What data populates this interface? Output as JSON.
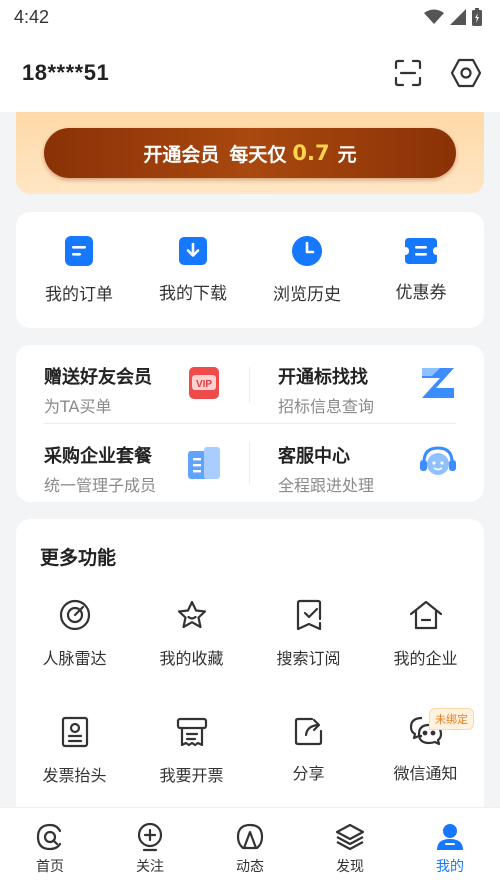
{
  "status": {
    "time": "4:42"
  },
  "header": {
    "phone": "18****51"
  },
  "vip": {
    "label": "开通会员",
    "prefix": "每天仅",
    "price": "0.7",
    "unit": "元"
  },
  "quick": [
    {
      "label": "我的订单",
      "icon": "order-icon"
    },
    {
      "label": "我的下载",
      "icon": "download-icon"
    },
    {
      "label": "浏览历史",
      "icon": "clock-icon"
    },
    {
      "label": "优惠券",
      "icon": "coupon-icon"
    }
  ],
  "promo": [
    {
      "title": "赠送好友会员",
      "sub": "为TA买单",
      "icon": "vip-gift-icon"
    },
    {
      "title": "开通标找找",
      "sub": "招标信息查询",
      "icon": "z-logo-icon"
    },
    {
      "title": "采购企业套餐",
      "sub": "统一管理子成员",
      "icon": "building-icon"
    },
    {
      "title": "客服中心",
      "sub": "全程跟进处理",
      "icon": "customer-service-icon"
    }
  ],
  "more": {
    "title": "更多功能",
    "items": [
      {
        "label": "人脉雷达",
        "icon": "radar-icon"
      },
      {
        "label": "我的收藏",
        "icon": "star-icon"
      },
      {
        "label": "搜索订阅",
        "icon": "subscribe-icon"
      },
      {
        "label": "我的企业",
        "icon": "company-icon"
      },
      {
        "label": "发票抬头",
        "icon": "invoice-title-icon"
      },
      {
        "label": "我要开票",
        "icon": "invoice-icon"
      },
      {
        "label": "分享",
        "icon": "share-icon"
      },
      {
        "label": "微信通知",
        "icon": "wechat-icon",
        "badge": "未绑定"
      }
    ]
  },
  "tabs": [
    {
      "label": "首页",
      "icon": "home-icon"
    },
    {
      "label": "关注",
      "icon": "follow-icon"
    },
    {
      "label": "动态",
      "icon": "activity-icon"
    },
    {
      "label": "发现",
      "icon": "discover-icon"
    },
    {
      "label": "我的",
      "icon": "profile-icon",
      "active": true
    }
  ],
  "colors": {
    "accent": "#1677ff",
    "vip_button": "#8a3206",
    "vip_price": "#ffd54a",
    "vip_banner": "#ffd9a8"
  }
}
